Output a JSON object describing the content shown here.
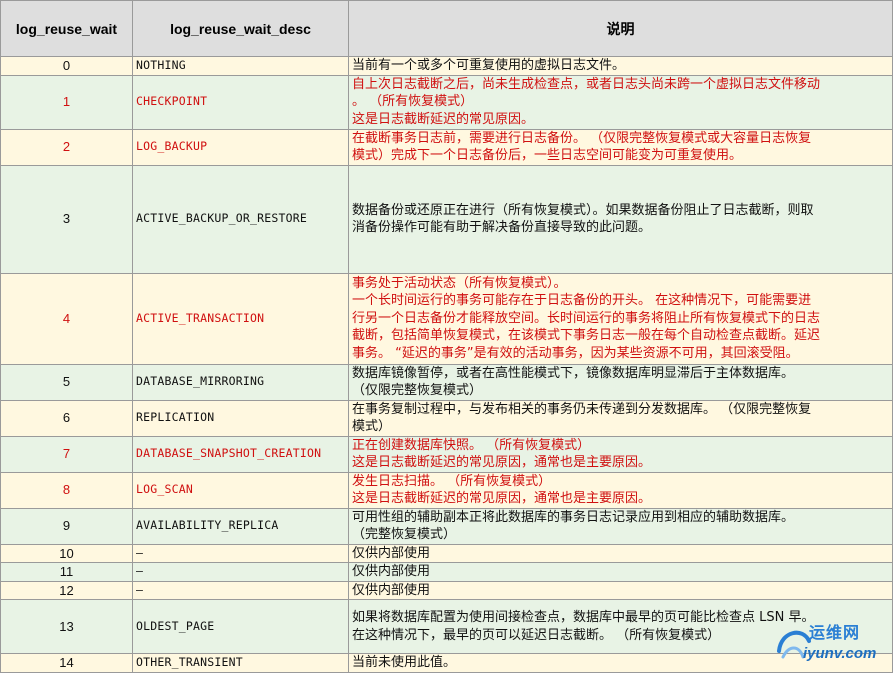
{
  "table": {
    "headers": [
      "log_reuse_wait",
      "log_reuse_wait_desc",
      "说明"
    ],
    "rows": [
      {
        "num": "0",
        "code": "NOTHING",
        "desc": [
          "当前有一个或多个可重复使用的虚拟日志文件。"
        ]
      },
      {
        "num": "1",
        "code": "CHECKPOINT",
        "desc": [
          "自上次日志截断之后，尚未生成检查点，或者日志头尚未跨一个虚拟日志文件移动",
          "。 （所有恢复模式）",
          "这是日志截断延迟的常见原因。"
        ]
      },
      {
        "num": "2",
        "code": "LOG_BACKUP",
        "desc": [
          "在截断事务日志前，需要进行日志备份。 （仅限完整恢复模式或大容量日志恢复",
          "模式）完成下一个日志备份后，一些日志空间可能变为可重复使用。"
        ]
      },
      {
        "num": "3",
        "code": "ACTIVE_BACKUP_OR_RESTORE",
        "desc": [
          "数据备份或还原正在进行（所有恢复模式）。如果数据备份阻止了日志截断，则取",
          "消备份操作可能有助于解决备份直接导致的此问题。"
        ]
      },
      {
        "num": "4",
        "code": "ACTIVE_TRANSACTION",
        "desc": [
          "事务处于活动状态（所有恢复模式）。",
          "一个长时间运行的事务可能存在于日志备份的开头。 在这种情况下，可能需要进",
          "行另一个日志备份才能释放空间。长时间运行的事务将阻止所有恢复模式下的日志",
          "截断，包括简单恢复模式，在该模式下事务日志一般在每个自动检查点截断。延迟",
          "事务。 “延迟的事务”是有效的活动事务，因为某些资源不可用，其回滚受阻。"
        ]
      },
      {
        "num": "5",
        "code": "DATABASE_MIRRORING",
        "desc": [
          "数据库镜像暂停，或者在高性能模式下，镜像数据库明显滞后于主体数据库。",
          "（仅限完整恢复模式）"
        ]
      },
      {
        "num": "6",
        "code": "REPLICATION",
        "desc": [
          "在事务复制过程中，与发布相关的事务仍未传递到分发数据库。 （仅限完整恢复",
          "模式）"
        ]
      },
      {
        "num": "7",
        "code": "DATABASE_SNAPSHOT_CREATION",
        "desc": [
          "正在创建数据库快照。 （所有恢复模式）",
          "这是日志截断延迟的常见原因，通常也是主要原因。"
        ]
      },
      {
        "num": "8",
        "code": "LOG_SCAN",
        "desc": [
          "发生日志扫描。 （所有恢复模式）",
          "这是日志截断延迟的常见原因，通常也是主要原因。"
        ]
      },
      {
        "num": "9",
        "code": "AVAILABILITY_REPLICA",
        "desc": [
          "可用性组的辅助副本正将此数据库的事务日志记录应用到相应的辅助数据库。",
          "（完整恢复模式）"
        ]
      },
      {
        "num": "10",
        "code": "—",
        "desc": [
          "仅供内部使用"
        ]
      },
      {
        "num": "11",
        "code": "—",
        "desc": [
          "仅供内部使用"
        ]
      },
      {
        "num": "12",
        "code": "—",
        "desc": [
          "仅供内部使用"
        ]
      },
      {
        "num": "13",
        "code": "OLDEST_PAGE",
        "desc": [
          "如果将数据库配置为使用间接检查点，数据库中最早的页可能比检查点 LSN 早。",
          "在这种情况下，最早的页可以延迟日志截断。 （所有恢复模式）"
        ]
      },
      {
        "num": "14",
        "code": "OTHER_TRANSIENT",
        "desc": [
          "当前未使用此值。"
        ]
      }
    ]
  },
  "watermark": {
    "cn": "运维网",
    "en": "iyunv.com"
  },
  "colors": {
    "red_text": "#d01010",
    "yellow_row": "#fff8e0",
    "green_row": "#e8f3e5",
    "header_bg": "#dedede"
  }
}
